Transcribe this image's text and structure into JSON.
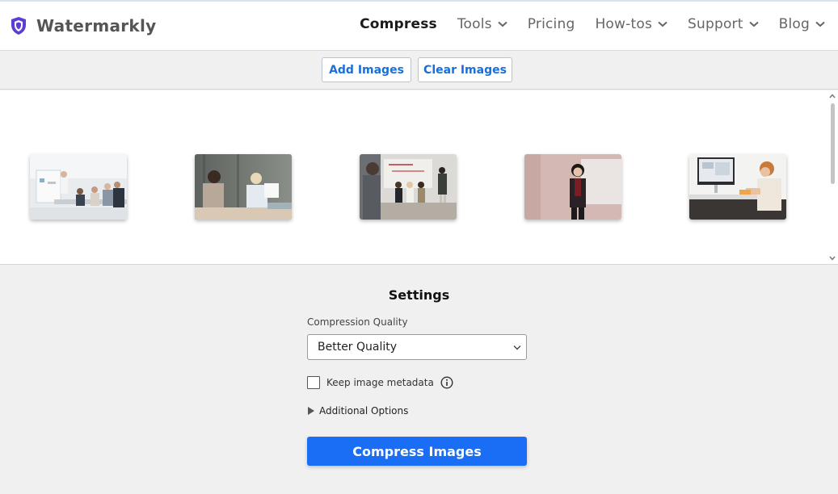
{
  "header": {
    "brand": "Watermarkly",
    "nav": [
      {
        "label": "Compress",
        "active": true,
        "dropdown": false
      },
      {
        "label": "Tools",
        "active": false,
        "dropdown": true
      },
      {
        "label": "Pricing",
        "active": false,
        "dropdown": false
      },
      {
        "label": "How-tos",
        "active": false,
        "dropdown": true
      },
      {
        "label": "Support",
        "active": false,
        "dropdown": true
      },
      {
        "label": "Blog",
        "active": false,
        "dropdown": true
      }
    ]
  },
  "toolbar": {
    "add_label": "Add Images",
    "clear_label": "Clear Images"
  },
  "gallery": {
    "images": [
      {
        "name": "office-meeting-whiteboard"
      },
      {
        "name": "business-women-conversation"
      },
      {
        "name": "group-presentation-audience"
      },
      {
        "name": "woman-presenter-red-jacket"
      },
      {
        "name": "desk-computer-workspace"
      }
    ]
  },
  "settings": {
    "title": "Settings",
    "quality_label": "Compression Quality",
    "quality_value": "Better Quality",
    "metadata_label": "Keep image metadata",
    "metadata_checked": false,
    "additional_label": "Additional Options",
    "compress_label": "Compress Images"
  },
  "colors": {
    "accent": "#1a6ef5",
    "link": "#1a6fd8",
    "logo": "#5b3fd0"
  }
}
